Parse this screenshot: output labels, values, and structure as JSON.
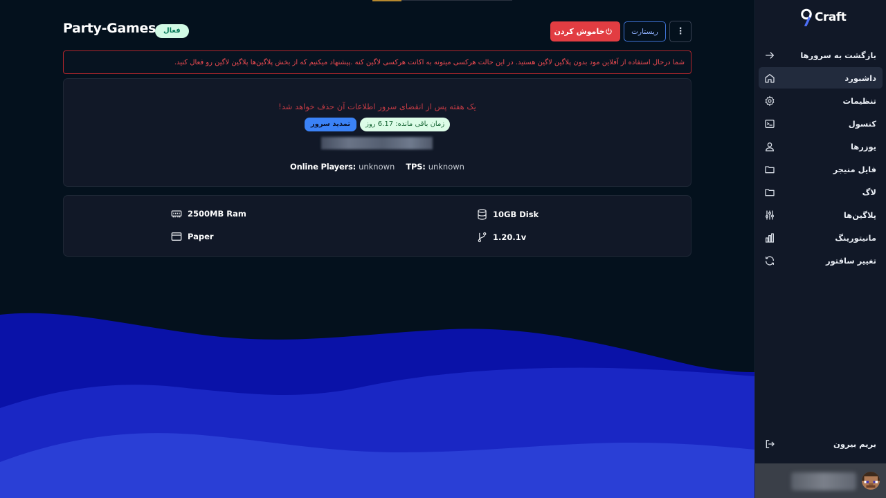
{
  "app": {
    "logo_text": "Craft",
    "logo_numeral": "9"
  },
  "sidebar": {
    "items": [
      {
        "label": "بازگشت به سرورها",
        "icon": "arrow-right-icon",
        "active": false
      },
      {
        "label": "داشبورد",
        "icon": "home-icon",
        "active": true
      },
      {
        "label": "تنظیمات",
        "icon": "gear-icon",
        "active": false
      },
      {
        "label": "کنسول",
        "icon": "terminal-icon",
        "active": false
      },
      {
        "label": "یوزرها",
        "icon": "users-icon",
        "active": false
      },
      {
        "label": "فایل منیجر",
        "icon": "folder-icon",
        "active": false
      },
      {
        "label": "لاگ",
        "icon": "folder-icon",
        "active": false
      },
      {
        "label": "پلاگین‌ها",
        "icon": "sliders-icon",
        "active": false
      },
      {
        "label": "مانیتورینگ",
        "icon": "chart-icon",
        "active": false
      },
      {
        "label": "تغییر سافتور",
        "icon": "refresh-icon",
        "active": false
      }
    ],
    "logout_label": "بریم بیرون"
  },
  "header": {
    "server_name": "Party-Games",
    "status": "فعال",
    "shutdown_label": "خاموش کردن",
    "restart_label": "ریستارت",
    "more_label": "⋮"
  },
  "alert": {
    "text": "شما درحال استفاده از آفلاین مود بدون پلاگین لاگین هستید. در این حالت هرکسی میتونه به اکانت هرکسی لاگین کنه .پیشنهاد میکنیم که از بخش پلاگین‌ها پلاگین لاگین رو فعال کنید."
  },
  "server_card": {
    "expire_note": "یک هفته پس از انقضای سرور اطلاعات آن حذف خواهد شد!",
    "renew_label": "تمدید سرور",
    "remaining_label": "زمان باقی مانده: 6.17 روز",
    "online_players_key": "Online Players:",
    "online_players_value": "unknown",
    "tps_key": "TPS:",
    "tps_value": "unknown"
  },
  "specs": {
    "ram": "2500MB Ram",
    "software": "Paper",
    "disk": "10GB Disk",
    "version": "1.20.1v"
  },
  "colors": {
    "background": "#04111d",
    "sidebar": "#111827",
    "card": "#111827",
    "danger": "#e23d42",
    "primary": "#3b82f6",
    "wave_dark": "#0a12a8",
    "wave_mid": "#1a27c4",
    "wave_light": "#2a3fd6"
  }
}
